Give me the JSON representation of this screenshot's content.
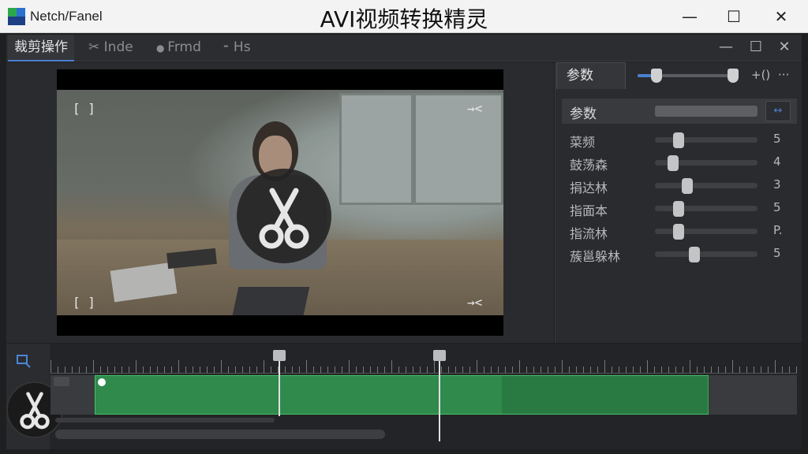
{
  "titlebar": {
    "app_name": "Netch/Fanel",
    "window_title": "AVI视频转换精灵",
    "minimize_glyph": "—",
    "maximize_glyph": "☐",
    "close_glyph": "✕"
  },
  "toolbar": {
    "tabs": [
      {
        "label": "裁剪操作",
        "icon": "none",
        "active": true
      },
      {
        "label": "Inde",
        "icon": "scissors-icon",
        "active": false
      },
      {
        "label": "Frmd",
        "icon": "dot-icon",
        "active": false
      },
      {
        "label": "Hs",
        "icon": "dash-icon",
        "active": false
      }
    ],
    "minimize_glyph": "—",
    "maximize_glyph": "☐",
    "close_glyph": "✕"
  },
  "video": {
    "corner_tl": "[ ]",
    "corner_tr": "→<",
    "corner_bl": "[ ]",
    "corner_br": "→<"
  },
  "params_panel": {
    "tab_label": "参数",
    "top_slider_fill_fraction": 0.19,
    "top_icon_1": "+()",
    "top_icon_2": "···",
    "header_label": "参数",
    "header_button_glyph": "↔",
    "rows": [
      {
        "label": "菜频",
        "value": "5",
        "fraction": 0.18
      },
      {
        "label": "鼓荡森",
        "value": "4",
        "fraction": 0.12
      },
      {
        "label": "捐达林",
        "value": "3",
        "fraction": 0.26
      },
      {
        "label": "指面本",
        "value": "5",
        "fraction": 0.18
      },
      {
        "label": "指流林",
        "value": "P.",
        "fraction": 0.18
      },
      {
        "label": "蔟邕躲林",
        "value": "5",
        "fraction": 0.33
      }
    ]
  },
  "timeline": {
    "zoom_icon": "search-icon",
    "clip_color": "#2f8a4c",
    "clip_border_color": "#45c26a",
    "accent_color": "#4a7fd0"
  }
}
